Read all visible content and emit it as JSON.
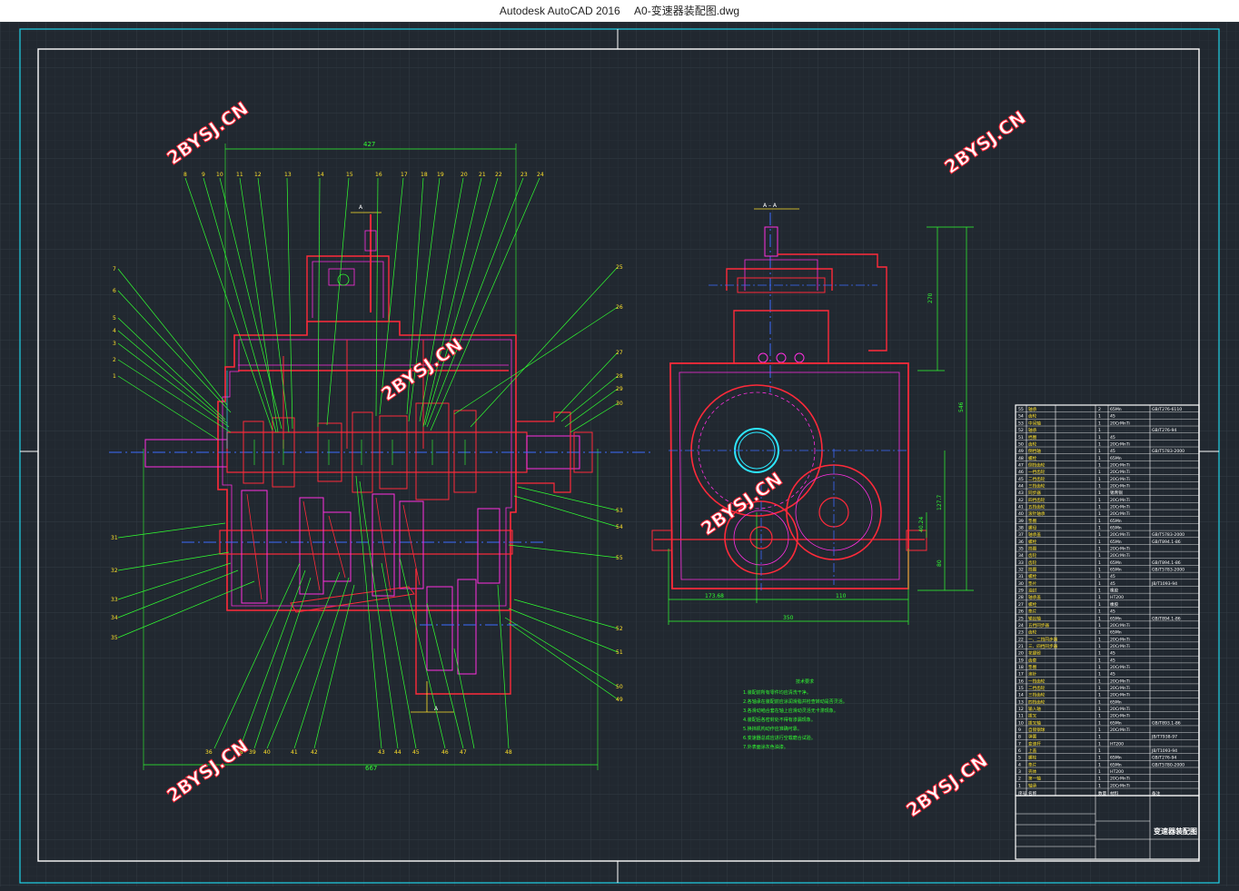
{
  "window": {
    "app_name": "Autodesk AutoCAD 2016",
    "document_name": "A0-变速器装配图.dwg"
  },
  "colors": {
    "background": "#212830",
    "grid": "#2b333c",
    "frame": "#ffffff",
    "sheet_border": "#1fd3e8",
    "part_red": "#ff2a3a",
    "part_magenta": "#ff2fe0",
    "leader_green": "#31ff31",
    "center_blue": "#3d6bff",
    "cyan": "#2de7ff",
    "yellow": "#ffe12a"
  },
  "watermarks": [
    "2BYSJ.CN",
    "2BYSJ.CN",
    "2BYSJ.CN",
    "2BYSJ.CN",
    "2BYSJ.CN",
    "2BYSJ.CN",
    "2BYSJ.CN"
  ],
  "main_view": {
    "dim_top": "427",
    "dim_bottom": "667",
    "section_mark": "A",
    "top_labels": [
      "8",
      "9",
      "10",
      "11",
      "12",
      "13",
      "14",
      "15",
      "16",
      "17",
      "18",
      "19",
      "20",
      "21",
      "22",
      "23",
      "24"
    ],
    "left_labels": [
      "7",
      "6",
      "5",
      "4",
      "3",
      "2",
      "1"
    ],
    "right_labels": [
      "25",
      "26",
      "27",
      "28",
      "29",
      "30"
    ],
    "right_lower_labels": [
      "53",
      "54",
      "55",
      "52",
      "51",
      "50",
      "49"
    ],
    "left_lower_labels": [
      "31",
      "32",
      "33",
      "34",
      "35"
    ],
    "bottom_labels": [
      "36",
      "38",
      "39",
      "40",
      "41",
      "42",
      "43",
      "44",
      "45",
      "46",
      "47",
      "48"
    ]
  },
  "side_view": {
    "section_label": "A – A",
    "dim_height_total": "546",
    "dim_height_top": "270",
    "dim_mid": "127.7",
    "dim_low": "80",
    "dim_small": "40.24",
    "dim_left": "173.68",
    "dim_right": "110",
    "dim_width": "350"
  },
  "tech_notes": {
    "heading": "技术要求",
    "lines": [
      "1.装配前所有零件均应清洗干净。",
      "2.各轴承在装配前应涂润滑脂并检查转动是否灵活。",
      "3.各滑动啮合套在轴上应滑动灵活无卡滞现象。",
      "4.装配后各密封处不得有渗漏现象。",
      "5.换挡机构动作应准确可靠。",
      "6.变速器总成应进行空载磨合试验。",
      "7.外表面涂灰色油漆。"
    ]
  },
  "bom": {
    "rows": [
      {
        "no": "55",
        "name": "轴承",
        "qty": "2",
        "material": "65Mn",
        "std": "GB/T276-6110"
      },
      {
        "no": "54",
        "name": "齿轮",
        "qty": "1",
        "material": "45",
        "std": ""
      },
      {
        "no": "53",
        "name": "中间轴",
        "qty": "1",
        "material": "20CrMnTi",
        "std": ""
      },
      {
        "no": "52",
        "name": "轴承",
        "qty": "1",
        "material": "",
        "std": "GB/T276-94"
      },
      {
        "no": "51",
        "name": "挡圈",
        "qty": "1",
        "material": "45",
        "std": ""
      },
      {
        "no": "50",
        "name": "齿轮",
        "qty": "1",
        "material": "20CrMnTi",
        "std": ""
      },
      {
        "no": "49",
        "name": "倒挡轴",
        "qty": "1",
        "material": "45",
        "std": "GB/T5783-2000"
      },
      {
        "no": "48",
        "name": "螺栓",
        "qty": "1",
        "material": "65Mn",
        "std": ""
      },
      {
        "no": "47",
        "name": "倒挡齿轮",
        "qty": "1",
        "material": "20CrMnTi",
        "std": ""
      },
      {
        "no": "46",
        "name": "一挡齿轮",
        "qty": "1",
        "material": "20CrMnTi",
        "std": ""
      },
      {
        "no": "45",
        "name": "二挡齿轮",
        "qty": "1",
        "material": "20CrMnTi",
        "std": ""
      },
      {
        "no": "44",
        "name": "三挡齿轮",
        "qty": "1",
        "material": "20CrMnTi",
        "std": ""
      },
      {
        "no": "43",
        "name": "同步器",
        "qty": "1",
        "material": "锡青铜",
        "std": ""
      },
      {
        "no": "42",
        "name": "四挡齿轮",
        "qty": "1",
        "material": "20CrMnTi",
        "std": ""
      },
      {
        "no": "41",
        "name": "五挡齿轮",
        "qty": "1",
        "material": "20CrMnTi",
        "std": ""
      },
      {
        "no": "40",
        "name": "滚针轴承",
        "qty": "1",
        "material": "20CrMnTi",
        "std": ""
      },
      {
        "no": "39",
        "name": "垫圈",
        "qty": "1",
        "material": "65Mn",
        "std": ""
      },
      {
        "no": "38",
        "name": "螺母",
        "qty": "1",
        "material": "65Mn",
        "std": ""
      },
      {
        "no": "37",
        "name": "轴承盖",
        "qty": "1",
        "material": "20CrMnTi",
        "std": "GB/T5783-2000"
      },
      {
        "no": "36",
        "name": "螺栓",
        "qty": "1",
        "material": "65Mn",
        "std": "GB/T894.1-86"
      },
      {
        "no": "35",
        "name": "挡圈",
        "qty": "1",
        "material": "20CrMnTi",
        "std": ""
      },
      {
        "no": "34",
        "name": "齿轮",
        "qty": "1",
        "material": "20CrMnTi",
        "std": ""
      },
      {
        "no": "33",
        "name": "齿轮",
        "qty": "1",
        "material": "65Mn",
        "std": "GB/T894.1-86"
      },
      {
        "no": "32",
        "name": "挡圈",
        "qty": "1",
        "material": "65Mn",
        "std": "GB/T5783-2000"
      },
      {
        "no": "31",
        "name": "螺栓",
        "qty": "1",
        "material": "45",
        "std": ""
      },
      {
        "no": "30",
        "name": "垫片",
        "qty": "1",
        "material": "45",
        "std": "JB/T1093-94"
      },
      {
        "no": "29",
        "name": "油封",
        "qty": "1",
        "material": "橡胶",
        "std": ""
      },
      {
        "no": "28",
        "name": "轴承盖",
        "qty": "1",
        "material": "HT200",
        "std": ""
      },
      {
        "no": "27",
        "name": "螺栓",
        "qty": "1",
        "material": "橡胶",
        "std": ""
      },
      {
        "no": "26",
        "name": "垫片",
        "qty": "1",
        "material": "45",
        "std": ""
      },
      {
        "no": "25",
        "name": "输出轴",
        "qty": "1",
        "material": "65Mn",
        "std": "GB/T894.1-86"
      },
      {
        "no": "24",
        "name": "五挡同步器",
        "qty": "1",
        "material": "20CrMnTi",
        "std": ""
      },
      {
        "no": "23",
        "name": "齿轮",
        "qty": "1",
        "material": "65Mn",
        "std": ""
      },
      {
        "no": "22",
        "name": "一、二挡同步器",
        "qty": "1",
        "material": "20CrMnTi",
        "std": ""
      },
      {
        "no": "21",
        "name": "三、四挡同步器",
        "qty": "1",
        "material": "20CrMnTi",
        "std": ""
      },
      {
        "no": "20",
        "name": "花键毂",
        "qty": "1",
        "material": "45",
        "std": ""
      },
      {
        "no": "19",
        "name": "齿套",
        "qty": "1",
        "material": "45",
        "std": ""
      },
      {
        "no": "18",
        "name": "垫圈",
        "qty": "1",
        "material": "20CrMnTi",
        "std": ""
      },
      {
        "no": "17",
        "name": "滚针",
        "qty": "1",
        "material": "45",
        "std": ""
      },
      {
        "no": "16",
        "name": "一挡齿轮",
        "qty": "1",
        "material": "20CrMnTi",
        "std": ""
      },
      {
        "no": "15",
        "name": "二挡齿轮",
        "qty": "1",
        "material": "20CrMnTi",
        "std": ""
      },
      {
        "no": "14",
        "name": "三挡齿轮",
        "qty": "1",
        "material": "20CrMnTi",
        "std": ""
      },
      {
        "no": "13",
        "name": "四挡齿轮",
        "qty": "1",
        "material": "65Mn",
        "std": ""
      },
      {
        "no": "12",
        "name": "输入轴",
        "qty": "1",
        "material": "20CrMnTi",
        "std": ""
      },
      {
        "no": "11",
        "name": "拨叉",
        "qty": "1",
        "material": "20CrMnTi",
        "std": ""
      },
      {
        "no": "10",
        "name": "拨叉轴",
        "qty": "1",
        "material": "65Mn",
        "std": "GB/T893.1-86"
      },
      {
        "no": "9",
        "name": "自锁钢球",
        "qty": "1",
        "material": "20CrMnTi",
        "std": ""
      },
      {
        "no": "8",
        "name": "弹簧",
        "qty": "1",
        "material": "",
        "std": "JB/T7938-97"
      },
      {
        "no": "7",
        "name": "变速杆",
        "qty": "1",
        "material": "HT200",
        "std": ""
      },
      {
        "no": "6",
        "name": "上盖",
        "qty": "1",
        "material": "",
        "std": "JB/T1093-94"
      },
      {
        "no": "5",
        "name": "螺栓",
        "qty": "1",
        "material": "65Mn",
        "std": "GB/T276-94"
      },
      {
        "no": "4",
        "name": "垫片",
        "qty": "1",
        "material": "65Mn",
        "std": "GB/T5780-2000"
      },
      {
        "no": "3",
        "name": "壳体",
        "qty": "1",
        "material": "HT200",
        "std": ""
      },
      {
        "no": "2",
        "name": "第一轴",
        "qty": "1",
        "material": "20CrMnTi",
        "std": ""
      },
      {
        "no": "1",
        "name": "轴承",
        "qty": "1",
        "material": "20CrMnTi",
        "std": ""
      }
    ],
    "header": {
      "no": "序号",
      "name": "名称",
      "qty": "数量",
      "material": "材料",
      "std": "备注"
    }
  },
  "title_block": {
    "drawing_title": "变速器装配图"
  }
}
